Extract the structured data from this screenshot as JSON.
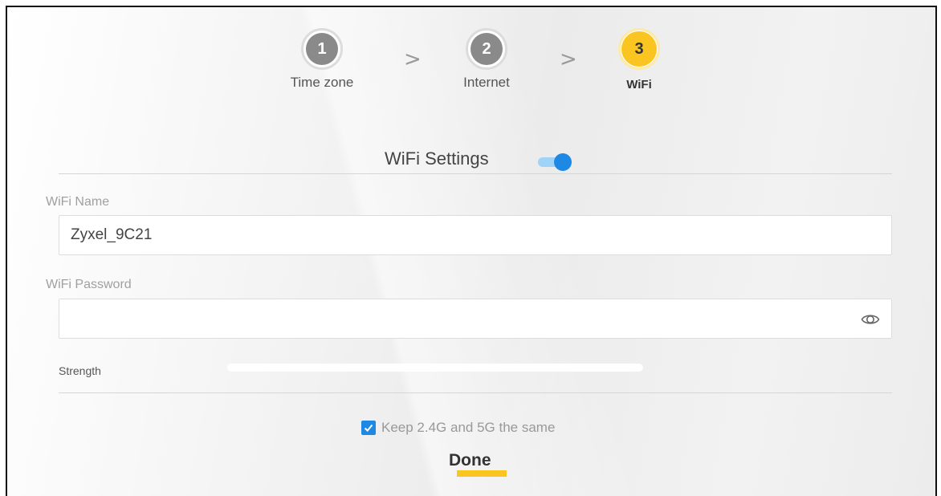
{
  "stepper": {
    "steps": [
      {
        "number": "1",
        "label": "Time zone",
        "state": "done"
      },
      {
        "number": "2",
        "label": "Internet",
        "state": "done"
      },
      {
        "number": "3",
        "label": "WiFi",
        "state": "active"
      }
    ],
    "separator": ">"
  },
  "wifi_settings": {
    "title": "WiFi Settings",
    "enabled": true
  },
  "wifi_name": {
    "label": "WiFi Name",
    "value": "Zyxel_9C21"
  },
  "wifi_password": {
    "label": "WiFi Password",
    "value": "",
    "icon": "eye-icon"
  },
  "strength": {
    "label": "Strength",
    "level": 0
  },
  "same_band": {
    "label": "Keep 2.4G and 5G the same",
    "checked": true
  },
  "done_button": {
    "label": "Done"
  },
  "colors": {
    "accent": "#fac520",
    "toggle_on": "#1e88e5",
    "checkbox": "#1e88e5"
  }
}
